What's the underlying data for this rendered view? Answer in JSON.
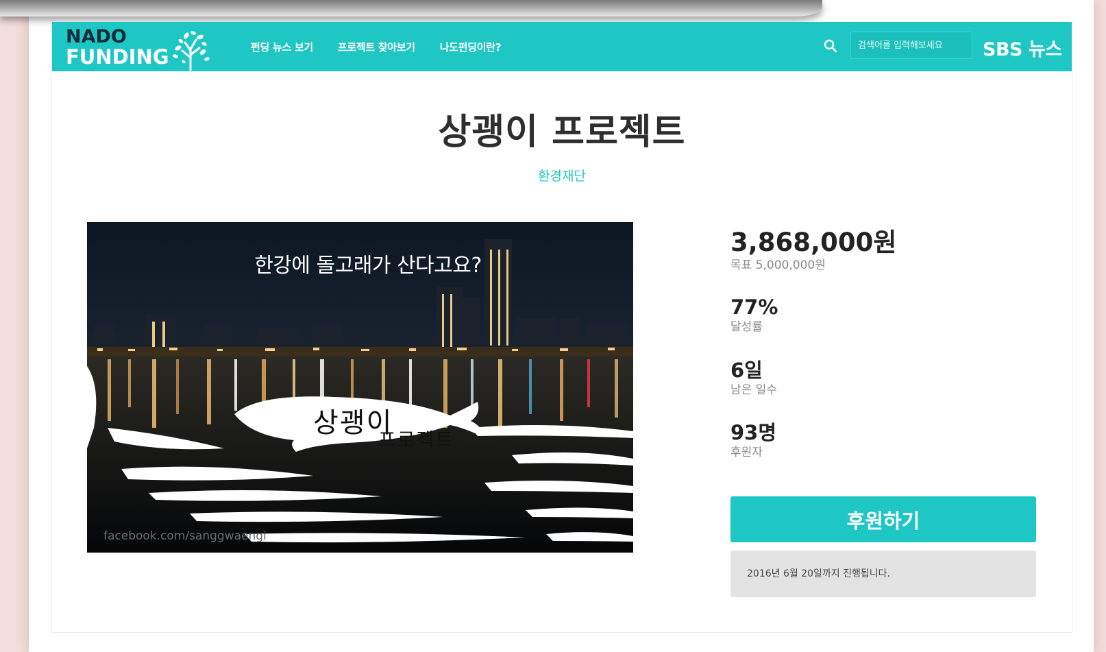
{
  "header": {
    "logo_line1": "NADO",
    "logo_line2": "FUNDING",
    "nav": [
      {
        "label": "펀딩 뉴스 보기"
      },
      {
        "label": "프로젝트 찾아보기"
      },
      {
        "label": "나도펀딩이란?"
      }
    ],
    "search_placeholder": "검색어를 입력해보세요",
    "partner": "SBS 뉴스"
  },
  "project": {
    "title": "상괭이 프로젝트",
    "organization": "환경재단",
    "image": {
      "headline": "한강에 돌고래가 산다고요?",
      "whale_title": "상괭이",
      "whale_subtitle": "프로젝트",
      "credit": "facebook.com/sanggwaengi"
    }
  },
  "stats": {
    "raised": "3,868,000원",
    "goal": "목표 5,000,000원",
    "percent": "77%",
    "percent_label": "달성률",
    "days": "6일",
    "days_label": "남은 일수",
    "backers": "93명",
    "backers_label": "후원자"
  },
  "actions": {
    "support_button": "후원하기",
    "deadline_notice": "2016년 6월 20일까지 진행됩니다."
  },
  "colors": {
    "accent": "#1ec7c4",
    "logo_dark": "#0f2c3a",
    "background": "#f3dedb"
  }
}
